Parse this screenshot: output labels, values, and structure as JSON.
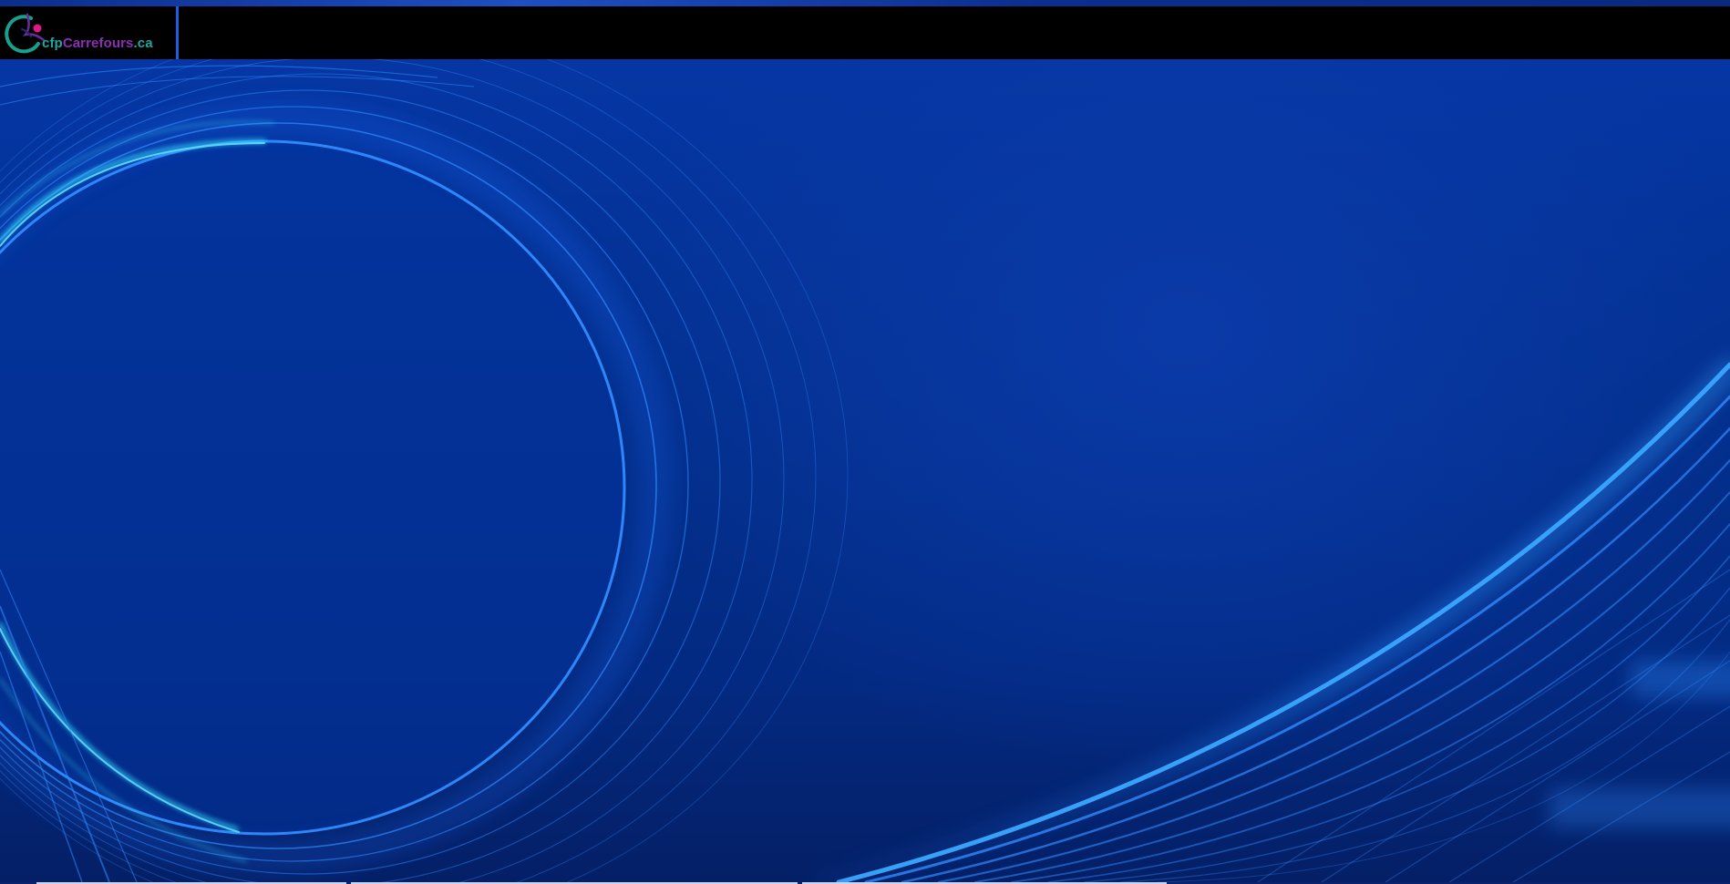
{
  "brand": {
    "name_prefix": "cfp",
    "name_main": "Carrefours",
    "name_suffix": ".ca",
    "colors": {
      "prefix": "#21a6a0",
      "main": "#8b2fb5",
      "suffix": "#21a6a0",
      "figure_pink": "#e0198a",
      "arc_teal": "#1a9e8f"
    }
  },
  "header": {
    "background": "#000000",
    "accent": "#1e5fe0"
  },
  "hero": {
    "background": "#04297a",
    "line_color": "#2f8cff",
    "highlight_color": "#35e0ff"
  }
}
